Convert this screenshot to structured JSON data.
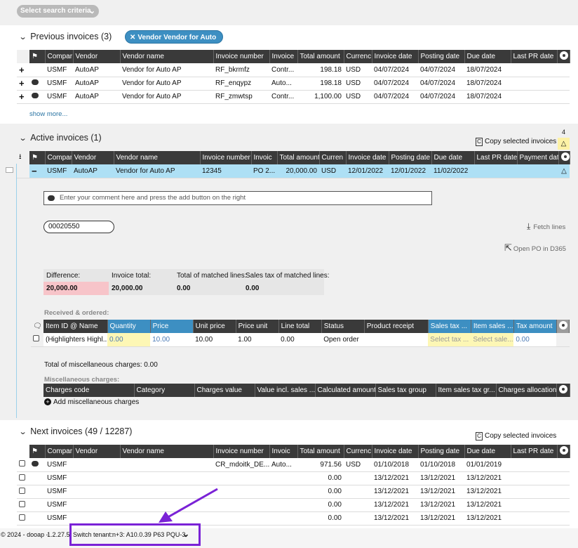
{
  "criteria": {
    "label": "Select search criteria"
  },
  "previous": {
    "title": "Previous invoices (3)",
    "filter_chip": "Vendor Vendor for Auto AP",
    "columns": [
      "Compar",
      "Vendor",
      "Vendor name",
      "Invoice number",
      "Invoice",
      "Total amount",
      "Currenc",
      "Invoice date",
      "Posting date",
      "Due date",
      "Last PR date"
    ],
    "rows": [
      [
        "USMF",
        "AutoAP",
        "Vendor for Auto AP",
        "RF_bkrmfz",
        "Contr...",
        "198.18",
        "USD",
        "04/07/2024",
        "04/07/2024",
        "18/07/2024",
        ""
      ],
      [
        "USMF",
        "AutoAP",
        "Vendor for Auto AP",
        "RF_enqypz",
        "Auto...",
        "198.18",
        "USD",
        "04/07/2024",
        "04/07/2024",
        "18/07/2024",
        ""
      ],
      [
        "USMF",
        "AutoAP",
        "Vendor for Auto AP",
        "RF_zmwtsp",
        "Contr...",
        "1,100.00",
        "USD",
        "04/07/2024",
        "04/07/2024",
        "18/07/2024",
        ""
      ]
    ],
    "show_more": "show more..."
  },
  "active": {
    "title": "Active invoices (1)",
    "copy_label": "Copy selected invoices",
    "warn_count": "4",
    "columns": [
      "Compar",
      "Vendor",
      "Vendor name",
      "Invoice number",
      "Invoic",
      "Total amount",
      "Curren",
      "Invoice date",
      "Posting date",
      "Due date",
      "Last PR date",
      "Payment date"
    ],
    "row": [
      "USMF",
      "AutoAP",
      "Vendor for Auto AP",
      "12345",
      "PO 2...",
      "20,000.00",
      "USD",
      "12/01/2022",
      "12/01/2022",
      "11/02/2022",
      "",
      ""
    ],
    "comment_placeholder": "Enter your comment here and press the add button on the right",
    "po_number": "00020550",
    "fetch_lines": "Fetch lines",
    "open_po": "Open PO in D365",
    "summary": {
      "diff_label": "Difference:",
      "diff_value": "20,000.00",
      "total_label": "Invoice total:",
      "total_value": "20,000.00",
      "matched_label": "Total of matched lines:",
      "matched_value": "0.00",
      "tax_label": "Sales tax of matched lines:",
      "tax_value": "0.00"
    },
    "received_label": "Received & ordered:",
    "lines_columns": [
      "Item ID @ Name",
      "Quantity",
      "Price",
      "Unit price",
      "Price unit",
      "Line total",
      "Status",
      "Product receipt",
      "Sales tax ...",
      "Item sales ...",
      "Tax amount"
    ],
    "lines_row": [
      "(Highlighters Highl...",
      "0.00",
      "10.00",
      "10.00",
      "1.00",
      "0.00",
      "Open order",
      "",
      "Select tax ...",
      "Select sale...",
      "0.00"
    ],
    "misc_total": "Total of miscellaneous charges: 0.00",
    "misc_label": "Miscellaneous charges:",
    "misc_columns": [
      "Charges code",
      "Category",
      "Charges value",
      "Value incl. sales ...",
      "Calculated amount",
      "Sales tax group",
      "Item sales tax gr...",
      "Charges allocation"
    ],
    "add_misc": "Add miscellaneous charges"
  },
  "next": {
    "title": "Next invoices (49 / 12287)",
    "copy_label": "Copy selected invoices",
    "columns": [
      "Compar",
      "Vendor",
      "Vendor name",
      "Invoice number",
      "Invoic",
      "Total amount",
      "Currenc",
      "Invoice date",
      "Posting date",
      "Due date",
      "Last PR date"
    ],
    "rows": [
      [
        "USMF",
        "",
        "",
        "CR_mdoitk_DE...",
        "Auto...",
        "971.56",
        "USD",
        "01/10/2018",
        "01/10/2018",
        "01/01/2019",
        ""
      ],
      [
        "USMF",
        "",
        "",
        "",
        "",
        "0.00",
        "",
        "13/12/2021",
        "13/12/2021",
        "13/12/2021",
        ""
      ],
      [
        "USMF",
        "",
        "",
        "",
        "",
        "0.00",
        "",
        "13/12/2021",
        "13/12/2021",
        "13/12/2021",
        ""
      ],
      [
        "USMF",
        "",
        "",
        "",
        "",
        "0.00",
        "",
        "13/12/2021",
        "13/12/2021",
        "13/12/2021",
        ""
      ],
      [
        "USMF",
        "",
        "",
        "",
        "",
        "0.00",
        "",
        "13/12/2021",
        "13/12/2021",
        "13/12/2021",
        ""
      ]
    ]
  },
  "footer": {
    "copyright": "© 2024 - dooap -",
    "version": "1.2.27.5",
    "switch_label": "Switch tenant:",
    "tenant": "n+3: A10.0.39 P63 PQU-3"
  },
  "colors": {
    "accent": "#3d8fc2",
    "annotation": "#7a22d6",
    "selected_row": "#aee0f5",
    "difference": "#f7c4c9"
  }
}
